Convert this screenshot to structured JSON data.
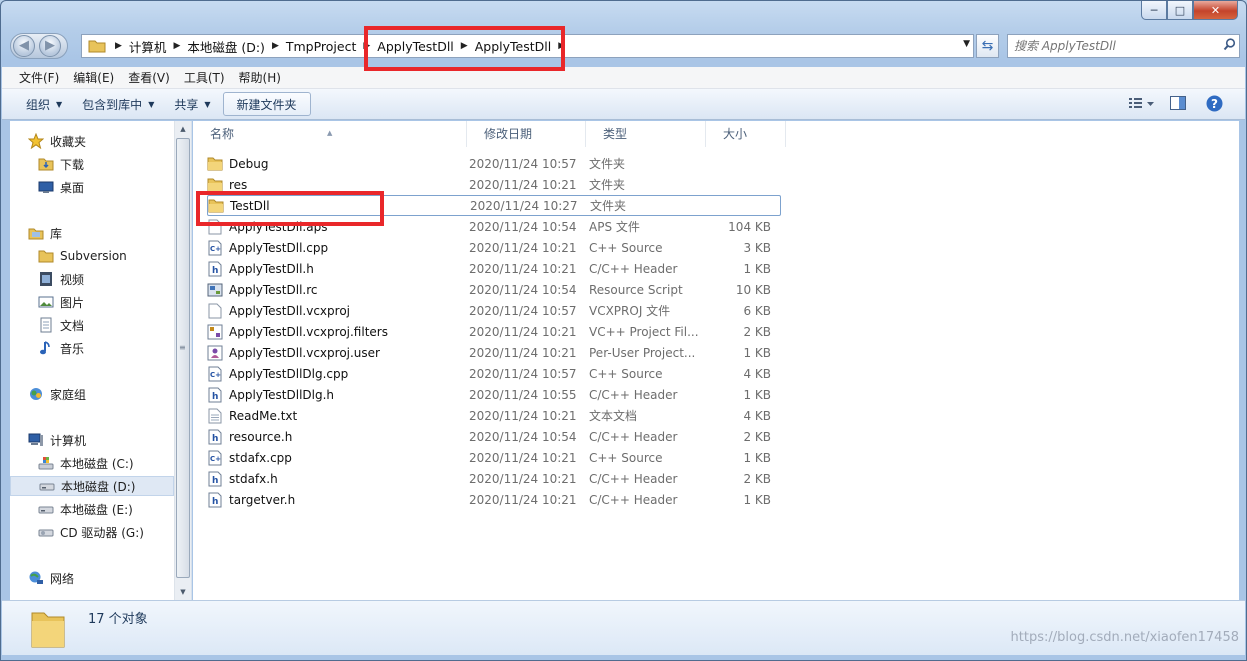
{
  "window": {
    "caption": {
      "minimize": "─",
      "maximize": "□",
      "close": "✕"
    }
  },
  "nav": {
    "back": "◀",
    "forward": "▶"
  },
  "address": {
    "crumbs": [
      "计算机",
      "本地磁盘 (D:)",
      "TmpProject",
      "ApplyTestDll",
      "ApplyTestDll"
    ]
  },
  "search": {
    "placeholder": "搜索 ApplyTestDll"
  },
  "menu": [
    "文件(F)",
    "编辑(E)",
    "查看(V)",
    "工具(T)",
    "帮助(H)"
  ],
  "toolbar": {
    "organize": "组织",
    "include_in_library": "包含到库中",
    "share": "共享",
    "new_folder": "新建文件夹"
  },
  "sidebar": {
    "favorites": "收藏夹",
    "fav_items": [
      "下载",
      "桌面"
    ],
    "libraries": "库",
    "lib_items": [
      "Subversion",
      "视频",
      "图片",
      "文档",
      "音乐"
    ],
    "homegroup": "家庭组",
    "computer": "计算机",
    "drives": [
      "本地磁盘 (C:)",
      "本地磁盘 (D:)",
      "本地磁盘 (E:)",
      "CD 驱动器 (G:)"
    ],
    "network": "网络"
  },
  "columns": {
    "name": "名称",
    "date": "修改日期",
    "type": "类型",
    "size": "大小"
  },
  "files": [
    {
      "name": "Debug",
      "date": "2020/11/24 10:57",
      "type": "文件夹",
      "size": "",
      "icon": "folder"
    },
    {
      "name": "res",
      "date": "2020/11/24 10:21",
      "type": "文件夹",
      "size": "",
      "icon": "folder"
    },
    {
      "name": "TestDll",
      "date": "2020/11/24 10:27",
      "type": "文件夹",
      "size": "",
      "icon": "folder"
    },
    {
      "name": "ApplyTestDll.aps",
      "date": "2020/11/24 10:54",
      "type": "APS 文件",
      "size": "104 KB",
      "icon": "file"
    },
    {
      "name": "ApplyTestDll.cpp",
      "date": "2020/11/24 10:21",
      "type": "C++ Source",
      "size": "3 KB",
      "icon": "cpp"
    },
    {
      "name": "ApplyTestDll.h",
      "date": "2020/11/24 10:21",
      "type": "C/C++ Header",
      "size": "1 KB",
      "icon": "h"
    },
    {
      "name": "ApplyTestDll.rc",
      "date": "2020/11/24 10:54",
      "type": "Resource Script",
      "size": "10 KB",
      "icon": "rc"
    },
    {
      "name": "ApplyTestDll.vcxproj",
      "date": "2020/11/24 10:57",
      "type": "VCXPROJ 文件",
      "size": "6 KB",
      "icon": "file"
    },
    {
      "name": "ApplyTestDll.vcxproj.filters",
      "date": "2020/11/24 10:21",
      "type": "VC++ Project Fil...",
      "size": "2 KB",
      "icon": "vcfilter"
    },
    {
      "name": "ApplyTestDll.vcxproj.user",
      "date": "2020/11/24 10:21",
      "type": "Per-User Project...",
      "size": "1 KB",
      "icon": "user"
    },
    {
      "name": "ApplyTestDllDlg.cpp",
      "date": "2020/11/24 10:57",
      "type": "C++ Source",
      "size": "4 KB",
      "icon": "cpp"
    },
    {
      "name": "ApplyTestDllDlg.h",
      "date": "2020/11/24 10:55",
      "type": "C/C++ Header",
      "size": "1 KB",
      "icon": "h"
    },
    {
      "name": "ReadMe.txt",
      "date": "2020/11/24 10:21",
      "type": "文本文档",
      "size": "4 KB",
      "icon": "txt"
    },
    {
      "name": "resource.h",
      "date": "2020/11/24 10:54",
      "type": "C/C++ Header",
      "size": "2 KB",
      "icon": "h"
    },
    {
      "name": "stdafx.cpp",
      "date": "2020/11/24 10:21",
      "type": "C++ Source",
      "size": "1 KB",
      "icon": "cpp"
    },
    {
      "name": "stdafx.h",
      "date": "2020/11/24 10:21",
      "type": "C/C++ Header",
      "size": "2 KB",
      "icon": "h"
    },
    {
      "name": "targetver.h",
      "date": "2020/11/24 10:21",
      "type": "C/C++ Header",
      "size": "1 KB",
      "icon": "h"
    }
  ],
  "status": {
    "count": "17 个对象"
  },
  "watermark": "https://blog.csdn.net/xiaofen17458",
  "colors": {
    "highlight": "#e9272a",
    "accent": "#1e395b"
  }
}
